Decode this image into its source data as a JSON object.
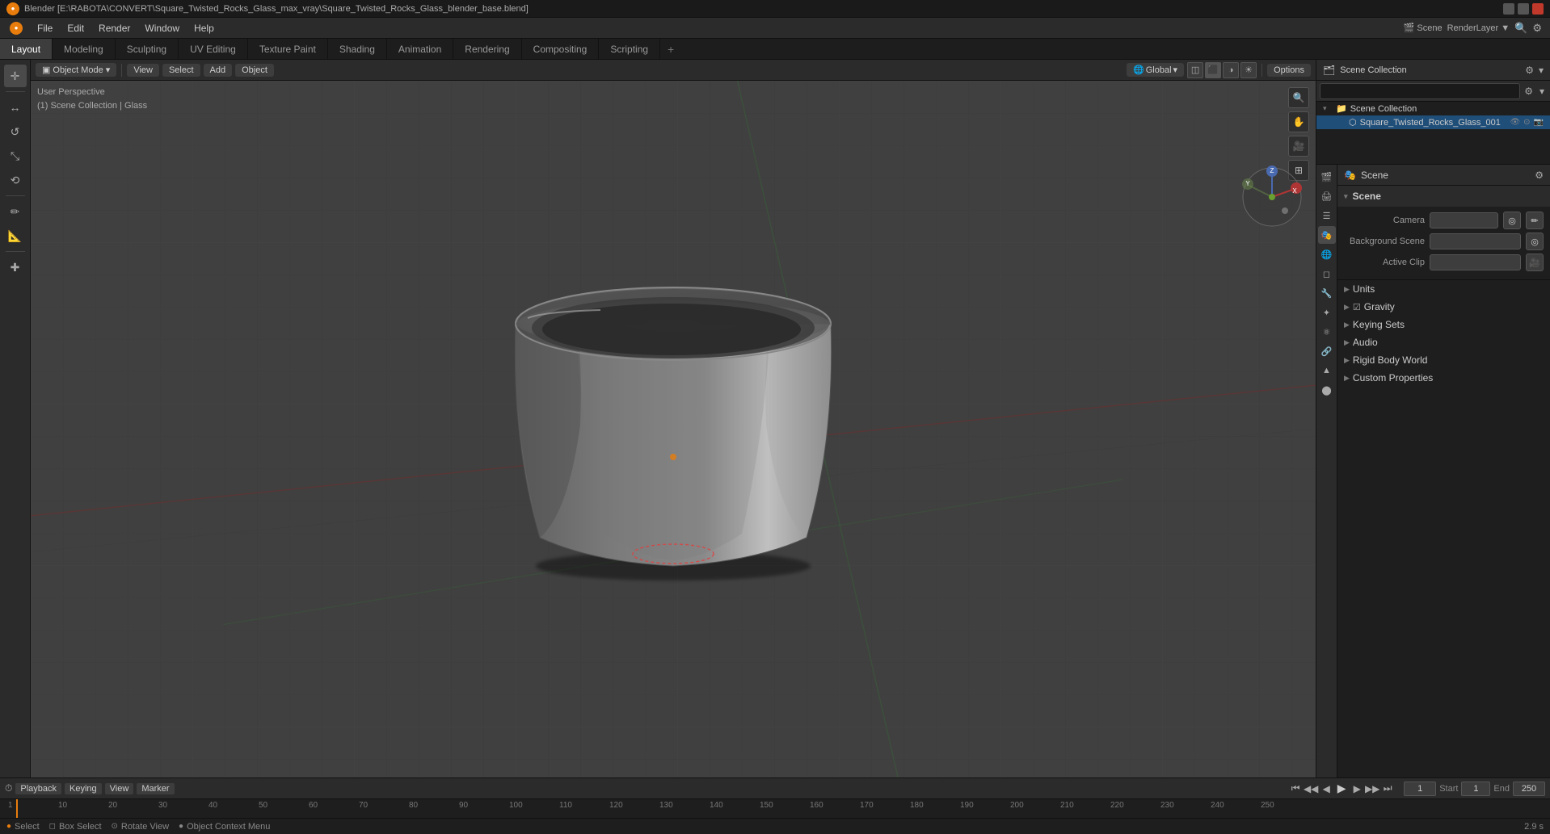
{
  "titlebar": {
    "title": "Blender [E:\\RABOTA\\CONVERT\\Square_Twisted_Rocks_Glass_max_vray\\Square_Twisted_Rocks_Glass_blender_base.blend]",
    "app_name": "Blender"
  },
  "menubar": {
    "items": [
      "Blender",
      "File",
      "Edit",
      "Render",
      "Window",
      "Help"
    ]
  },
  "workspace_tabs": {
    "tabs": [
      "Layout",
      "Modeling",
      "Sculpting",
      "UV Editing",
      "Texture Paint",
      "Shading",
      "Animation",
      "Rendering",
      "Compositing",
      "Scripting"
    ],
    "active": "Layout",
    "add_label": "+"
  },
  "viewport_header": {
    "mode": "Object Mode",
    "view_label": "View",
    "select_label": "Select",
    "add_label": "Add",
    "object_label": "Object",
    "transform_global": "Global",
    "options_label": "Options"
  },
  "viewport_info": {
    "perspective": "User Perspective",
    "collection": "(1) Scene Collection | Glass"
  },
  "left_toolbar": {
    "tools": [
      "cursor",
      "move",
      "rotate",
      "scale",
      "transform",
      "annotate",
      "measure",
      "add"
    ]
  },
  "right_viewport_controls": {
    "icons": [
      "🔍",
      "✋",
      "🎥",
      "⬛"
    ]
  },
  "outliner": {
    "title": "Scene Collection",
    "search_placeholder": "",
    "items": [
      {
        "label": "Square_Twisted_Rocks_Glass_001",
        "icon": "📦",
        "indent": 1,
        "selected": true
      }
    ]
  },
  "properties": {
    "header": "Scene",
    "search_placeholder": "",
    "sections": [
      {
        "id": "scene",
        "label": "Scene",
        "collapsed": false,
        "rows": [
          {
            "label": "Camera",
            "value": ""
          },
          {
            "label": "Background Scene",
            "value": ""
          },
          {
            "label": "Active Clip",
            "value": ""
          }
        ]
      },
      {
        "id": "units",
        "label": "Units",
        "collapsed": true,
        "rows": []
      },
      {
        "id": "gravity",
        "label": "Gravity",
        "collapsed": true,
        "rows": []
      },
      {
        "id": "keying_sets",
        "label": "Keying Sets",
        "collapsed": true,
        "rows": []
      },
      {
        "id": "audio",
        "label": "Audio",
        "collapsed": true,
        "rows": []
      },
      {
        "id": "rigid_body_world",
        "label": "Rigid Body World",
        "collapsed": true,
        "rows": []
      },
      {
        "id": "custom_properties",
        "label": "Custom Properties",
        "collapsed": true,
        "rows": []
      }
    ]
  },
  "timeline": {
    "playback_label": "Playback",
    "keying_label": "Keying",
    "view_label": "View",
    "marker_label": "Marker",
    "start_label": "Start",
    "start_value": "1",
    "end_label": "End",
    "end_value": "250",
    "current_frame": "1",
    "frame_markers": [
      "1",
      "10",
      "20",
      "30",
      "40",
      "50",
      "60",
      "70",
      "80",
      "90",
      "100",
      "110",
      "120",
      "130",
      "140",
      "150",
      "160",
      "170",
      "180",
      "190",
      "200",
      "210",
      "220",
      "230",
      "240",
      "250"
    ]
  },
  "status_bar": {
    "select_label": "Select",
    "box_select_label": "Box Select",
    "rotate_view_label": "Rotate View",
    "object_context_label": "Object Context Menu",
    "frame_count": "2.9 s"
  },
  "colors": {
    "accent": "#e87d0d",
    "bg_dark": "#1a1a1a",
    "bg_medium": "#2b2b2b",
    "bg_panel": "#1e1e1e",
    "active_tab": "#3d3d3d",
    "selected": "#1f4e79",
    "grid": "#3a3a3a",
    "axis_x": "#af3535",
    "axis_y": "#4f8040"
  }
}
